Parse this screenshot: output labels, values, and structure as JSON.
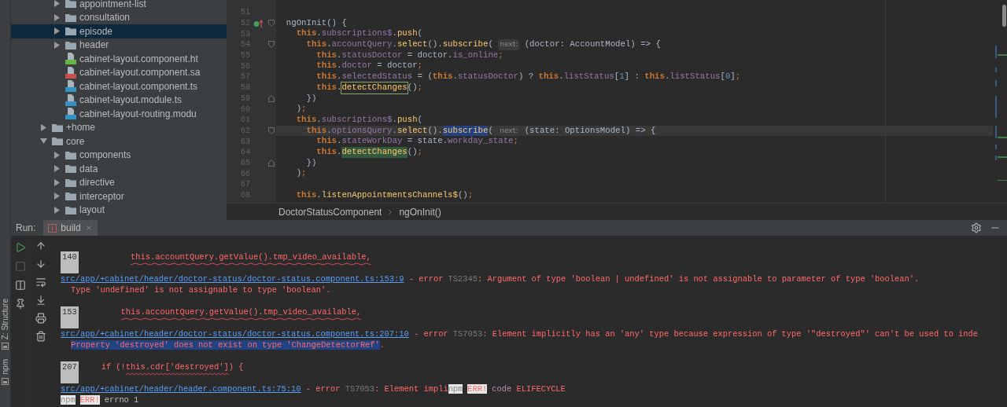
{
  "project_tree": [
    {
      "children": [
        {
          "label": "appointment-list",
          "kind": "folder",
          "expanded": false,
          "selected": false
        },
        {
          "label": "consultation",
          "kind": "folder",
          "expanded": false,
          "selected": false
        },
        {
          "label": "episode",
          "kind": "folder",
          "expanded": false,
          "selected": true
        },
        {
          "label": "header",
          "kind": "folder",
          "expanded": false,
          "selected": false
        },
        {
          "label": "cabinet-layout.component.ht",
          "kind": "html",
          "selected": false
        },
        {
          "label": "cabinet-layout.component.sa",
          "kind": "sass",
          "selected": false
        },
        {
          "label": "cabinet-layout.component.ts",
          "kind": "ts",
          "selected": false
        },
        {
          "label": "cabinet-layout.module.ts",
          "kind": "ts",
          "selected": false
        },
        {
          "label": "cabinet-layout-routing.modu",
          "kind": "ts",
          "selected": false
        }
      ]
    },
    {
      "label": "+home",
      "kind": "folder",
      "expanded": false,
      "selected": false
    },
    {
      "label": "core",
      "kind": "folder",
      "expanded": true,
      "selected": false,
      "children": [
        {
          "label": "components",
          "kind": "folder",
          "expanded": false,
          "selected": false
        },
        {
          "label": "data",
          "kind": "folder",
          "expanded": false,
          "selected": false
        },
        {
          "label": "directive",
          "kind": "folder",
          "expanded": false,
          "selected": false
        },
        {
          "label": "interceptor",
          "kind": "folder",
          "expanded": false,
          "selected": false
        },
        {
          "label": "layout",
          "kind": "folder",
          "expanded": false,
          "selected": false
        }
      ]
    }
  ],
  "editor": {
    "lines": [
      {
        "n": "51"
      },
      {
        "n": "52",
        "gutter": [
          {
            "kind": "implements"
          },
          {
            "kind": "fold_start"
          }
        ],
        "tokens": [
          {
            "kind": "plain",
            "text": "  ngOnInit() {"
          }
        ]
      },
      {
        "n": "53",
        "tokens": [
          {
            "kind": "kw",
            "text": "    this"
          },
          {
            "kind": "plain",
            "text": "."
          },
          {
            "kind": "prop",
            "text": "subscriptions$"
          },
          {
            "kind": "plain",
            "text": "."
          },
          {
            "kind": "method",
            "text": "push"
          },
          {
            "kind": "plain",
            "text": "("
          }
        ]
      },
      {
        "n": "54",
        "gutter": [
          {
            "kind": "fold_start"
          }
        ],
        "tokens": [
          {
            "kind": "kw",
            "text": "      this"
          },
          {
            "kind": "plain",
            "text": "."
          },
          {
            "kind": "prop",
            "text": "accountQuery"
          },
          {
            "kind": "plain",
            "text": "."
          },
          {
            "kind": "method",
            "text": "select"
          },
          {
            "kind": "plain",
            "text": "()."
          },
          {
            "kind": "method",
            "text": "subscribe"
          },
          {
            "kind": "plain",
            "text": "( "
          },
          {
            "kind": "hint",
            "text": "next:"
          },
          {
            "kind": "plain",
            "text": " (doctor: AccountModel) => {"
          }
        ]
      },
      {
        "n": "55",
        "tokens": [
          {
            "kind": "kw",
            "text": "        this"
          },
          {
            "kind": "plain",
            "text": "."
          },
          {
            "kind": "prop",
            "text": "statusDoctor"
          },
          {
            "kind": "plain",
            "text": " = doctor."
          },
          {
            "kind": "prop",
            "text": "is_online"
          },
          {
            "kind": "punct",
            "text": ";"
          }
        ]
      },
      {
        "n": "56",
        "tokens": [
          {
            "kind": "kw",
            "text": "        this"
          },
          {
            "kind": "plain",
            "text": "."
          },
          {
            "kind": "prop",
            "text": "doctor"
          },
          {
            "kind": "plain",
            "text": " = doctor"
          },
          {
            "kind": "punct",
            "text": ";"
          }
        ]
      },
      {
        "n": "57",
        "tokens": [
          {
            "kind": "kw",
            "text": "        this"
          },
          {
            "kind": "plain",
            "text": "."
          },
          {
            "kind": "prop",
            "text": "selectedStatus"
          },
          {
            "kind": "plain",
            "text": " = ("
          },
          {
            "kind": "kw",
            "text": "this"
          },
          {
            "kind": "plain",
            "text": "."
          },
          {
            "kind": "prop",
            "text": "statusDoctor"
          },
          {
            "kind": "plain",
            "text": ") ? "
          },
          {
            "kind": "kw",
            "text": "this"
          },
          {
            "kind": "plain",
            "text": "."
          },
          {
            "kind": "prop",
            "text": "listStatus"
          },
          {
            "kind": "plain",
            "text": "["
          },
          {
            "kind": "num",
            "text": "1"
          },
          {
            "kind": "plain",
            "text": "] : "
          },
          {
            "kind": "kw",
            "text": "this"
          },
          {
            "kind": "plain",
            "text": "."
          },
          {
            "kind": "prop",
            "text": "listStatus"
          },
          {
            "kind": "plain",
            "text": "["
          },
          {
            "kind": "num",
            "text": "0"
          },
          {
            "kind": "plain",
            "text": "]"
          },
          {
            "kind": "punct",
            "text": ";"
          }
        ]
      },
      {
        "n": "58",
        "tokens": [
          {
            "kind": "kw",
            "text": "        this"
          },
          {
            "kind": "plain",
            "text": "."
          },
          {
            "kind": "method_box",
            "text": "detectChanges"
          },
          {
            "kind": "plain",
            "text": "()"
          },
          {
            "kind": "punct",
            "text": ";"
          }
        ]
      },
      {
        "n": "59",
        "gutter": [
          {
            "kind": "fold_end"
          }
        ],
        "tokens": [
          {
            "kind": "plain",
            "text": "      })"
          }
        ]
      },
      {
        "n": "60",
        "tokens": [
          {
            "kind": "plain",
            "text": "    )"
          },
          {
            "kind": "punct",
            "text": ";"
          }
        ]
      },
      {
        "n": "61",
        "tokens": [
          {
            "kind": "kw",
            "text": "    this"
          },
          {
            "kind": "plain",
            "text": "."
          },
          {
            "kind": "prop",
            "text": "subscriptions$"
          },
          {
            "kind": "plain",
            "text": "."
          },
          {
            "kind": "method",
            "text": "push"
          },
          {
            "kind": "plain",
            "text": "("
          }
        ]
      },
      {
        "n": "62",
        "current": true,
        "gutter": [
          {
            "kind": "fold_start"
          }
        ],
        "tokens": [
          {
            "kind": "kw",
            "text": "      this"
          },
          {
            "kind": "plain",
            "text": "."
          },
          {
            "kind": "prop",
            "text": "optionsQuery"
          },
          {
            "kind": "plain",
            "text": "."
          },
          {
            "kind": "method",
            "text": "select"
          },
          {
            "kind": "plain",
            "text": "()."
          },
          {
            "kind": "method_blue",
            "text": "subscribe"
          },
          {
            "kind": "plain",
            "text": "( "
          },
          {
            "kind": "hint",
            "text": "next:"
          },
          {
            "kind": "plain",
            "text": " (state: OptionsModel) => {"
          }
        ]
      },
      {
        "n": "63",
        "tokens": [
          {
            "kind": "kw",
            "text": "        this"
          },
          {
            "kind": "plain",
            "text": "."
          },
          {
            "kind": "prop",
            "text": "stateWorkDay"
          },
          {
            "kind": "plain",
            "text": " = state."
          },
          {
            "kind": "prop",
            "text": "workday_state"
          },
          {
            "kind": "punct",
            "text": ";"
          }
        ]
      },
      {
        "n": "64",
        "tokens": [
          {
            "kind": "kw",
            "text": "        this"
          },
          {
            "kind": "plain",
            "text": "."
          },
          {
            "kind": "method_green",
            "text": "detectChanges"
          },
          {
            "kind": "plain",
            "text": "()"
          },
          {
            "kind": "punct",
            "text": ";"
          }
        ]
      },
      {
        "n": "65",
        "gutter": [
          {
            "kind": "fold_end"
          }
        ],
        "tokens": [
          {
            "kind": "plain",
            "text": "      })"
          }
        ]
      },
      {
        "n": "66",
        "tokens": [
          {
            "kind": "plain",
            "text": "    )"
          },
          {
            "kind": "punct",
            "text": ";"
          }
        ]
      },
      {
        "n": "67"
      },
      {
        "n": "68",
        "tokens": [
          {
            "kind": "kw",
            "text": "    this"
          },
          {
            "kind": "plain",
            "text": "."
          },
          {
            "kind": "method",
            "text": "listenAppointmentsChannels$"
          },
          {
            "kind": "plain",
            "text": "()"
          },
          {
            "kind": "punct",
            "text": ";"
          }
        ]
      }
    ],
    "breadcrumbs": [
      "DoctorStatusComponent",
      "ngOnInit()"
    ]
  },
  "run_panel": {
    "title": "Run:",
    "tabs": [
      {
        "label": "build",
        "selected": true
      }
    ],
    "console": [
      {
        "kind": "source",
        "number": "140",
        "parts": [
          {
            "kind": "red",
            "text": "          this.accountQuery.getValue().tmp_video_available,",
            "squiggle": true
          }
        ]
      },
      {
        "kind": "line",
        "parts": [
          {
            "kind": "link",
            "text": "src/app/+cabinet/header/doctor-status/doctor-status.component.ts:153:9"
          },
          {
            "kind": "red",
            "text": " - error "
          },
          {
            "kind": "grey",
            "text": "TS2345"
          },
          {
            "kind": "red",
            "text": ": Argument of type 'boolean | undefined' is not assignable to parameter of type 'boolean'."
          }
        ]
      },
      {
        "kind": "detail",
        "parts": [
          {
            "kind": "red",
            "text": "Type 'undefined' is not assignable to type 'boolean'."
          }
        ]
      },
      {
        "kind": "source",
        "number": "153",
        "parts": [
          {
            "kind": "red",
            "text": "        this.accountQuery.getValue().tmp_video_available,",
            "squiggle": true
          }
        ]
      },
      {
        "kind": "line",
        "parts": [
          {
            "kind": "link",
            "text": "src/app/+cabinet/header/doctor-status/doctor-status.component.ts:207:10"
          },
          {
            "kind": "red",
            "text": " - error "
          },
          {
            "kind": "grey",
            "text": "TS7053"
          },
          {
            "kind": "red",
            "text": ": Element implicitly has an 'any' type because expression of type '\"destroyed\"' can't be used to inde"
          }
        ]
      },
      {
        "kind": "detail",
        "parts": [
          {
            "kind": "red_selected",
            "text": "Property 'destroyed' does not exist on type 'ChangeDetectorRef'"
          },
          {
            "kind": "red",
            "text": "."
          }
        ]
      },
      {
        "kind": "source",
        "number": "207",
        "parts": [
          {
            "kind": "red",
            "text": "    if (!"
          },
          {
            "kind": "red",
            "text": "this.cdr['destroyed']",
            "squiggle": true
          },
          {
            "kind": "red",
            "text": ") {"
          }
        ]
      },
      {
        "kind": "line",
        "parts": [
          {
            "kind": "link",
            "text": "src/app/+cabinet/header/header.component.ts:75:10"
          },
          {
            "kind": "red",
            "text": " - error "
          },
          {
            "kind": "grey",
            "text": "TS7053"
          },
          {
            "kind": "red",
            "text": ": Element impli"
          },
          {
            "kind": "tag_grey",
            "text": "npm"
          },
          {
            "kind": "tag_red",
            "text": "ERR!"
          },
          {
            "kind": "purple",
            "text": "code"
          },
          {
            "kind": "red",
            "text": " ELIFECYCLE"
          }
        ]
      },
      {
        "kind": "line",
        "parts": [
          {
            "kind": "tag_grey",
            "text": "npm"
          },
          {
            "kind": "tag_red",
            "text": "ERR!"
          },
          {
            "kind": "plain",
            "text": "errno 1"
          }
        ]
      }
    ]
  },
  "side_stripe": [
    {
      "label": "Z: Structure"
    },
    {
      "label": "npm"
    }
  ]
}
